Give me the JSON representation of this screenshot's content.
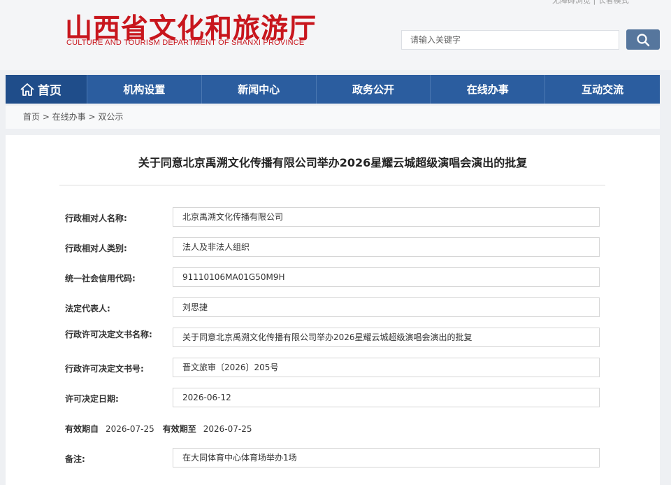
{
  "header": {
    "logo_cn": "山西省文化和旅游厅",
    "logo_en": "CULTURE AND TOURISM DEPARTMENT OF SHANXI PROVINCE",
    "top_links": "无障碍浏览 | 长者模式",
    "search_placeholder": "请输入关键字",
    "search_icon": "search-icon"
  },
  "nav": {
    "home_icon": "home-icon",
    "items": [
      "首页",
      "机构设置",
      "新闻中心",
      "政务公开",
      "在线办事",
      "互动交流"
    ]
  },
  "breadcrumb": "首页 > 在线办事 > 双公示",
  "article": {
    "title": "关于同意北京禹溯文化传播有限公司举办2026星耀云城超级演唱会演出的批复",
    "fields": [
      {
        "label": "行政相对人名称:",
        "value": "北京禹溯文化传播有限公司"
      },
      {
        "label": "行政相对人类别:",
        "value": "法人及非法人组织"
      },
      {
        "label": "统一社会信用代码:",
        "value": "91110106MA01G50M9H"
      },
      {
        "label": "法定代表人:",
        "value": "刘思捷"
      },
      {
        "label": "行政许可决定文书名称:",
        "value": "关于同意北京禹溯文化传播有限公司举办2026星耀云城超级演唱会演出的批复"
      },
      {
        "label": "行政许可决定文书号:",
        "value": "晋文旅审〔2026〕205号"
      },
      {
        "label": "许可决定日期:",
        "value": "2026-06-12"
      }
    ],
    "validity": {
      "from_label": "有效期自",
      "from_value": "2026-07-25",
      "to_label": "有效期至",
      "to_value": "2026-07-25"
    },
    "remark": {
      "label": "备注:",
      "value": "在大同体育中心体育场举办1场"
    }
  },
  "colors": {
    "brand_red": "#c8161d",
    "nav_blue": "#2b5d9f",
    "nav_home_blue": "#1f4d8a",
    "search_button": "#56769d"
  }
}
